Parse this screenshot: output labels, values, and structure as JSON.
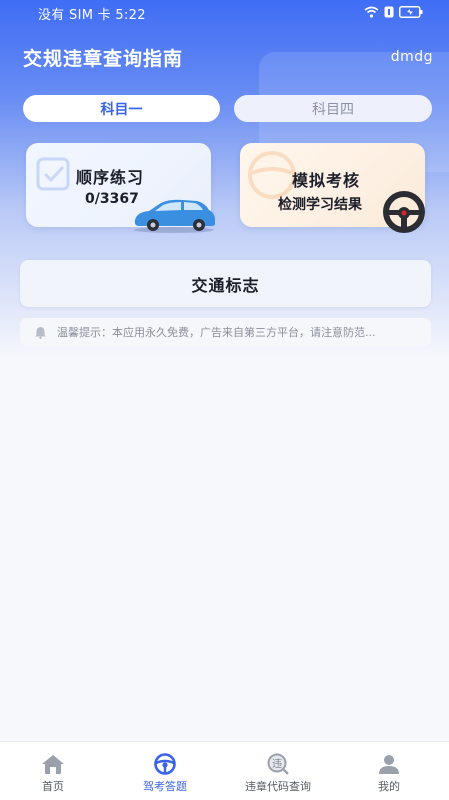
{
  "status_bar": {
    "carrier_time": "没有 SIM 卡 5:22",
    "icons": [
      "wifi-icon",
      "battery-saver-icon",
      "battery-icon"
    ]
  },
  "header": {
    "title": "交规违章查询指南",
    "user": "dmdg"
  },
  "tabs": [
    {
      "label": "科目一",
      "selected": true
    },
    {
      "label": "科目四",
      "selected": false
    }
  ],
  "cards": {
    "sequential": {
      "title": "顺序练习",
      "progress": "0/3367",
      "icon": "car-icon"
    },
    "mock_exam": {
      "title": "模拟考核",
      "subtitle": "检测学习结果",
      "icon": "steering-wheel-icon"
    }
  },
  "traffic_signs": {
    "label": "交通标志"
  },
  "notice": {
    "icon": "bell-icon",
    "text": "温馨提示：本应用永久免费，广告来自第三方平台，请注意防范..."
  },
  "bottom_nav": [
    {
      "label": "首页",
      "icon": "home-icon",
      "active": false
    },
    {
      "label": "驾考答题",
      "icon": "steering-wheel-icon",
      "active": true
    },
    {
      "label": "违章代码查询",
      "icon": "violation-search-icon",
      "active": false
    },
    {
      "label": "我的",
      "icon": "user-icon",
      "active": false
    }
  ],
  "colors": {
    "accent": "#3a64e8",
    "header_gradient_top": "#3f6df5",
    "background": "#f7f8fc"
  }
}
